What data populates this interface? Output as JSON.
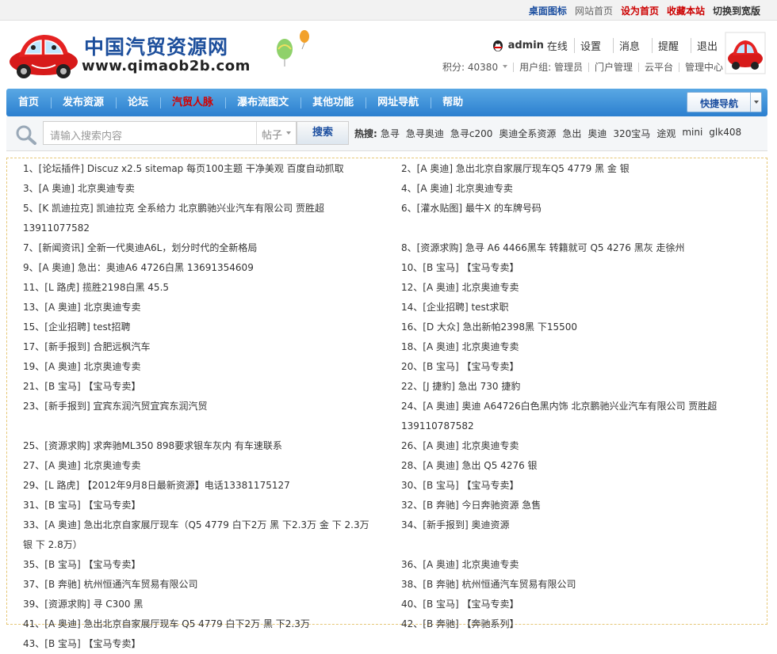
{
  "topbar": {
    "links": [
      {
        "label": "桌面图标",
        "style": "blue"
      },
      {
        "label": "网站首页",
        "style": "grey"
      },
      {
        "label": "设为首页",
        "style": "red"
      },
      {
        "label": "收藏本站",
        "style": "red"
      },
      {
        "label": "切换到宽版",
        "style": "dark"
      }
    ]
  },
  "header": {
    "site_title": "中国汽贸资源网",
    "site_url": "www.qimaob2b.com",
    "user": {
      "name": "admin",
      "status": "在线",
      "links": [
        "设置",
        "消息",
        "提醒",
        "退出"
      ]
    },
    "stats": {
      "credits": "积分: 40380",
      "group": "用户组: 管理员",
      "links": [
        "门户管理",
        "云平台",
        "管理中心"
      ]
    }
  },
  "nav": {
    "items": [
      {
        "label": "首页",
        "active": false
      },
      {
        "label": "发布资源",
        "active": false
      },
      {
        "label": "论坛",
        "active": false
      },
      {
        "label": "汽贸人脉",
        "active": true
      },
      {
        "label": "瀑布流图文",
        "active": false
      },
      {
        "label": "其他功能",
        "active": false
      },
      {
        "label": "网址导航",
        "active": false
      },
      {
        "label": "帮助",
        "active": false
      }
    ],
    "quick_nav": "快捷导航"
  },
  "search": {
    "placeholder": "请输入搜索内容",
    "type": "帖子",
    "button": "搜索",
    "hot_label": "热搜:",
    "hot_keywords": [
      "急寻",
      "急寻奥迪",
      "急寻c200",
      "奥迪全系资源",
      "急出",
      "奥迪",
      "320宝马",
      "途观",
      "mini",
      "glk408"
    ]
  },
  "threads": [
    "1、[论坛插件] Discuz x2.5 sitemap 每页100主题 干净美观 百度自动抓取",
    "2、[A 奥迪] 急出北京自家展厅现车Q5 4779 黑 金 银",
    "3、[A 奥迪] 北京奥迪专卖",
    "4、[A 奥迪] 北京奥迪专卖",
    "5、[K 凯迪拉克] 凯迪拉克 全系给力 北京鹏驰兴业汽车有限公司 贾胜超13911077582",
    "6、[灌水贴图] 最牛X 的车牌号码",
    "7、[新闻资讯] 全新一代奥迪A6L，划分时代的全新格局",
    "8、[资源求购] 急寻 A6 4466黑车 转籍就可 Q5 4276 黑灰 走徐州",
    "9、[A 奥迪] 急出：奥迪A6 4726白黑 13691354609",
    "10、[B 宝马] 【宝马专卖】",
    "11、[L 路虎] 揽胜2198白黑 45.5",
    "12、[A 奥迪] 北京奥迪专卖",
    "13、[A 奥迪] 北京奥迪专卖",
    "14、[企业招聘] test求职",
    "15、[企业招聘] test招聘",
    "16、[D 大众] 急出新帕2398黑 下15500",
    "17、[新手报到] 合肥远枫汽车",
    "18、[A 奥迪] 北京奥迪专卖",
    "19、[A 奥迪] 北京奥迪专卖",
    "20、[B 宝马] 【宝马专卖】",
    "21、[B 宝马] 【宝马专卖】",
    "22、[J 捷豹] 急出 730 捷豹",
    "23、[新手报到] 宜宾东润汽贸宜宾东润汽贸",
    "24、[A 奥迪] 奥迪 A64726白色黑内饰 北京鹏驰兴业汽车有限公司 贾胜超 139110787582",
    "25、[资源求购] 求奔驰ML350 898要求银车灰内 有车速联系",
    "26、[A 奥迪] 北京奥迪专卖",
    "27、[A 奥迪] 北京奥迪专卖",
    "28、[A 奥迪] 急出 Q5 4276 银",
    "29、[L 路虎] 【2012年9月8日最新资源】电话13381175127",
    "30、[B 宝马] 【宝马专卖】",
    "31、[B 宝马] 【宝马专卖】",
    "32、[B 奔驰] 今日奔驰资源 急售",
    "33、[A 奥迪] 急出北京自家展厅现车（Q5 4779 白下2万 黑 下2.3万 金 下 2.3万 银 下 2.8万）",
    "34、[新手报到] 奥迪资源",
    "35、[B 宝马] 【宝马专卖】",
    "36、[A 奥迪] 北京奥迪专卖",
    "37、[B 奔驰] 杭州恒通汽车贸易有限公司",
    "38、[B 奔驰] 杭州恒通汽车贸易有限公司",
    "39、[资源求购] 寻 C300 黑",
    "40、[B 宝马] 【宝马专卖】",
    "41、[A 奥迪] 急出北京自家展厅现车 Q5 4779 白下2万 黑 下2.3万",
    "42、[B 奔驰] 【奔驰系列】",
    "43、[B 宝马] 【宝马专卖】"
  ]
}
